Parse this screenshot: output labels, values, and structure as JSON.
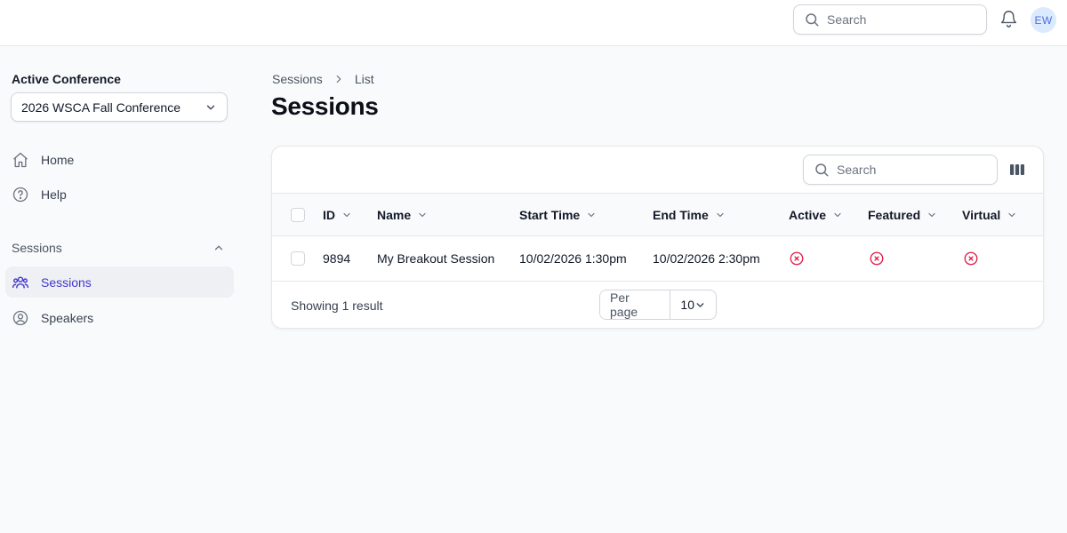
{
  "topbar": {
    "search_placeholder": "Search",
    "avatar_initials": "EW"
  },
  "sidebar": {
    "conference_label": "Active Conference",
    "conference_selected": "2026 WSCA Fall Conference",
    "nav": [
      {
        "label": "Home",
        "icon": "home-icon"
      },
      {
        "label": "Help",
        "icon": "help-circle-icon"
      }
    ],
    "group": {
      "label": "Sessions",
      "items": [
        {
          "label": "Sessions",
          "icon": "users-group-icon",
          "active": true
        },
        {
          "label": "Speakers",
          "icon": "user-circle-icon",
          "active": false
        }
      ]
    }
  },
  "breadcrumb": [
    "Sessions",
    "List"
  ],
  "page_title": "Sessions",
  "table": {
    "search_placeholder": "Search",
    "columns": [
      "ID",
      "Name",
      "Start Time",
      "End Time",
      "Active",
      "Featured",
      "Virtual"
    ],
    "rows": [
      {
        "id": "9894",
        "name": "My Breakout Session",
        "start_time": "10/02/2026 1:30pm",
        "end_time": "10/02/2026 2:30pm",
        "active": false,
        "featured": false,
        "virtual": false
      }
    ],
    "footer": {
      "result_text": "Showing 1 result",
      "per_page_label": "Per page",
      "per_page_value": "10"
    }
  },
  "colors": {
    "accent": "#4338ca",
    "false_icon": "#e11d48",
    "background": "#f9fafb"
  }
}
